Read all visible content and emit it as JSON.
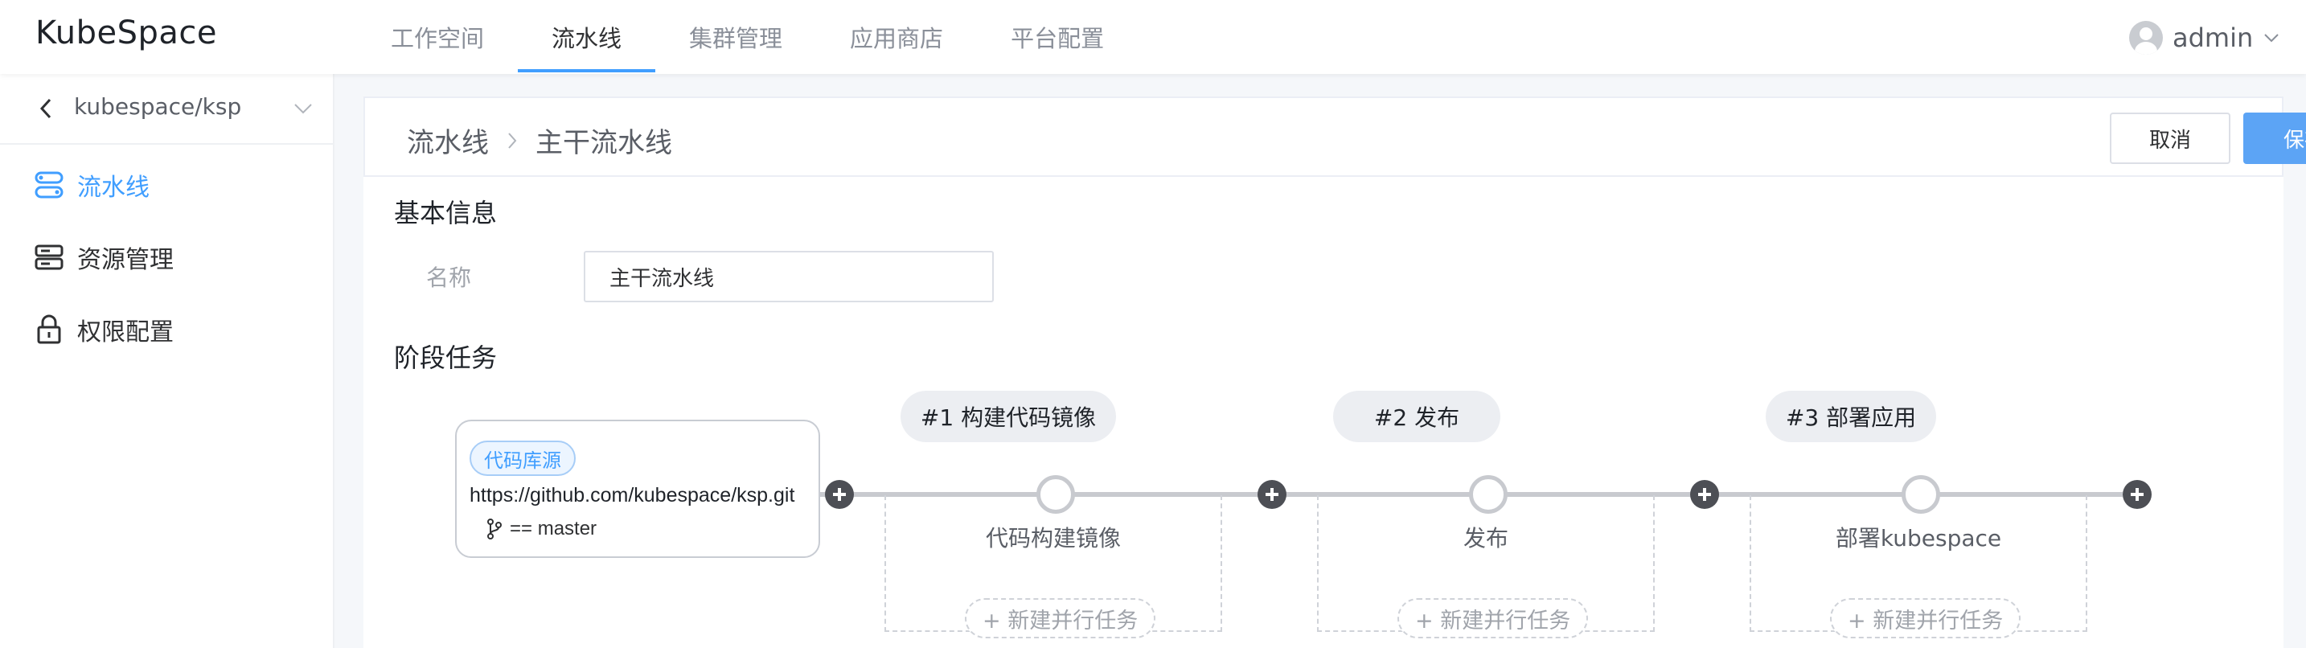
{
  "app": {
    "logo": "KubeSpace"
  },
  "nav": {
    "items": [
      {
        "label": "工作空间",
        "active": false
      },
      {
        "label": "流水线",
        "active": true
      },
      {
        "label": "集群管理",
        "active": false
      },
      {
        "label": "应用商店",
        "active": false
      },
      {
        "label": "平台配置",
        "active": false
      }
    ]
  },
  "user": {
    "name": "admin",
    "icon": "user-avatar-icon"
  },
  "sidebar": {
    "project": "kubespace/ksp",
    "items": [
      {
        "label": "流水线",
        "icon": "pipeline-icon",
        "active": true
      },
      {
        "label": "资源管理",
        "icon": "storage-icon",
        "active": false
      },
      {
        "label": "权限配置",
        "icon": "lock-icon",
        "active": false
      }
    ]
  },
  "header": {
    "breadcrumb": [
      "流水线",
      "主干流水线"
    ],
    "cancel_label": "取消",
    "save_label": "保存"
  },
  "basic": {
    "section_title": "基本信息",
    "name_label": "名称",
    "name_value": "主干流水线"
  },
  "stages_section": {
    "title": "阶段任务",
    "source": {
      "badge": "代码库源",
      "url": "https://github.com/kubespace/ksp.git",
      "branch": "== master"
    },
    "stages": [
      {
        "title": "#1 构建代码镜像",
        "task": "代码构建镜像",
        "add_label": "+ 新建并行任务"
      },
      {
        "title": "#2 发布",
        "task": "发布",
        "add_label": "+ 新建并行任务"
      },
      {
        "title": "#3 部署应用",
        "task": "部署kubespace",
        "add_label": "+ 新建并行任务"
      }
    ]
  },
  "colors": {
    "accent": "#409eff",
    "save_button": "#5ca4f5"
  }
}
